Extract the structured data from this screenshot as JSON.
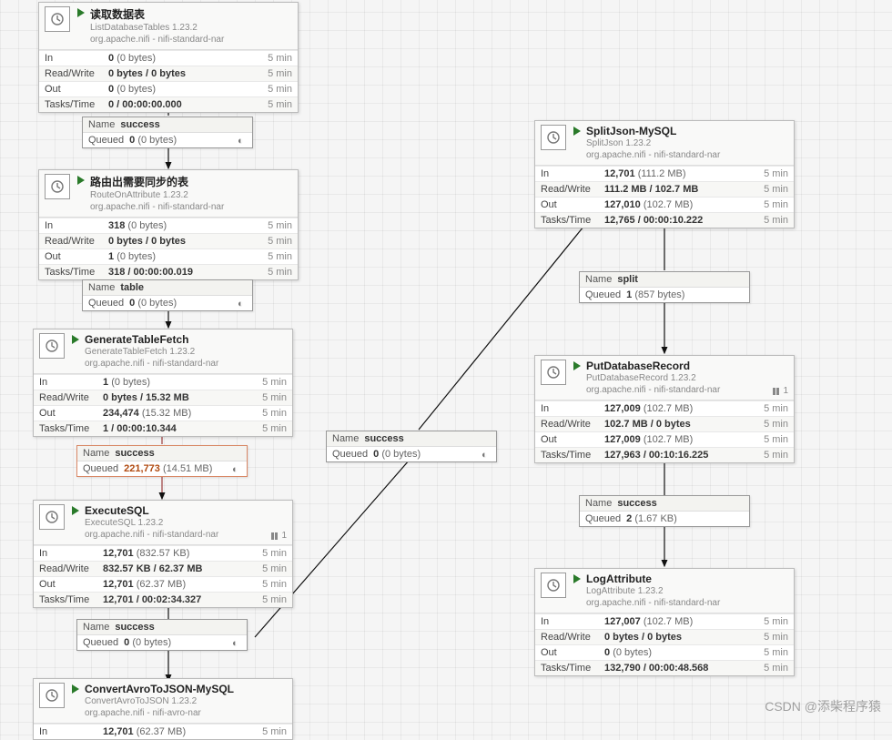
{
  "time_window": "5 min",
  "processors": {
    "p1": {
      "title": "读取数据表",
      "type": "ListDatabaseTables 1.23.2",
      "bundle": "org.apache.nifi - nifi-standard-nar",
      "in": "0",
      "in_size": "(0 bytes)",
      "rw": "0 bytes / 0 bytes",
      "out": "0",
      "out_size": "(0 bytes)",
      "tt": "0 / 00:00:00.000"
    },
    "p2": {
      "title": "路由出需要同步的表",
      "type": "RouteOnAttribute 1.23.2",
      "bundle": "org.apache.nifi - nifi-standard-nar",
      "in": "318",
      "in_size": "(0 bytes)",
      "rw": "0 bytes / 0 bytes",
      "out": "1",
      "out_size": "(0 bytes)",
      "tt": "318 / 00:00:00.019"
    },
    "p3": {
      "title": "GenerateTableFetch",
      "type": "GenerateTableFetch 1.23.2",
      "bundle": "org.apache.nifi - nifi-standard-nar",
      "in": "1",
      "in_size": "(0 bytes)",
      "rw": "0 bytes / 15.32 MB",
      "out": "234,474",
      "out_size": "(15.32 MB)",
      "tt": "1 / 00:00:10.344"
    },
    "p4": {
      "title": "ExecuteSQL",
      "type": "ExecuteSQL 1.23.2",
      "bundle": "org.apache.nifi - nifi-standard-nar",
      "threads": "1",
      "in": "12,701",
      "in_size": "(832.57 KB)",
      "rw": "832.57 KB / 62.37 MB",
      "out": "12,701",
      "out_size": "(62.37 MB)",
      "tt": "12,701 / 00:02:34.327"
    },
    "p5": {
      "title": "ConvertAvroToJSON-MySQL",
      "type": "ConvertAvroToJSON 1.23.2",
      "bundle": "org.apache.nifi - nifi-avro-nar",
      "in": "12,701",
      "in_size": "(62.37 MB)"
    },
    "p6": {
      "title": "SplitJson-MySQL",
      "type": "SplitJson 1.23.2",
      "bundle": "org.apache.nifi - nifi-standard-nar",
      "in": "12,701",
      "in_size": "(111.2 MB)",
      "rw": "111.2 MB / 102.7 MB",
      "out": "127,010",
      "out_size": "(102.7 MB)",
      "tt": "12,765 / 00:00:10.222"
    },
    "p7": {
      "title": "PutDatabaseRecord",
      "type": "PutDatabaseRecord 1.23.2",
      "bundle": "org.apache.nifi - nifi-standard-nar",
      "threads": "1",
      "in": "127,009",
      "in_size": "(102.7 MB)",
      "rw": "102.7 MB / 0 bytes",
      "out": "127,009",
      "out_size": "(102.7 MB)",
      "tt": "127,963 / 00:10:16.225"
    },
    "p8": {
      "title": "LogAttribute",
      "type": "LogAttribute 1.23.2",
      "bundle": "org.apache.nifi - nifi-standard-nar",
      "in": "127,007",
      "in_size": "(102.7 MB)",
      "rw": "0 bytes / 0 bytes",
      "out": "0",
      "out_size": "(0 bytes)",
      "tt": "132,790 / 00:00:48.568"
    }
  },
  "connections": {
    "c1": {
      "name": "success",
      "queued": "0",
      "size": "(0 bytes)"
    },
    "c2": {
      "name": "table",
      "queued": "0",
      "size": "(0 bytes)"
    },
    "c3": {
      "name": "success",
      "queued": "221,773",
      "size": "(14.51 MB)"
    },
    "c4": {
      "name": "success",
      "queued": "0",
      "size": "(0 bytes)"
    },
    "c5": {
      "name": "success",
      "queued": "0",
      "size": "(0 bytes)"
    },
    "c6": {
      "name": "split",
      "queued": "1",
      "size": "(857 bytes)"
    },
    "c7": {
      "name": "success",
      "queued": "2",
      "size": "(1.67 KB)"
    }
  },
  "labels": {
    "name": "Name",
    "queued": "Queued",
    "in": "In",
    "rw": "Read/Write",
    "out": "Out",
    "tt": "Tasks/Time"
  },
  "watermark": "CSDN @添柴程序猿"
}
